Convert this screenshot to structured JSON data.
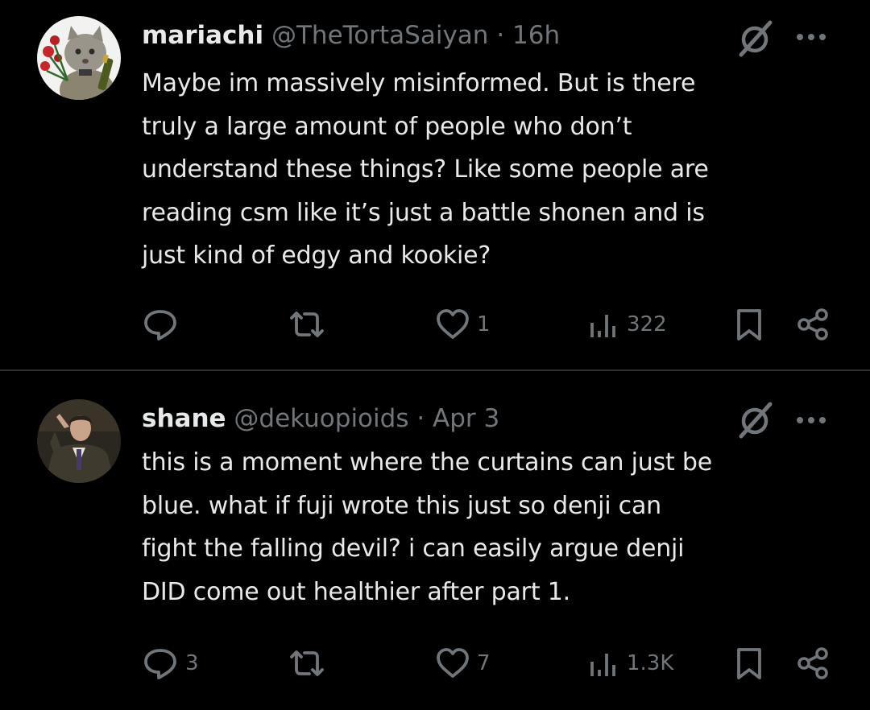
{
  "tweets": [
    {
      "display_name": "mariachi",
      "handle": "@TheTortaSaiyan",
      "separator": "·",
      "time": "16h",
      "text_lines": [
        "Maybe im massively misinformed. But is there",
        "truly a large amount of people who don’t",
        "understand these things? Like some people are",
        "reading csm like it’s just a battle shonen and is",
        "just kind of edgy and kookie?"
      ],
      "replies": "",
      "reposts": "",
      "likes": "1",
      "views": "322"
    },
    {
      "display_name": "shane",
      "handle": "@dekuopioids",
      "separator": "·",
      "time": "Apr 3",
      "text_lines": [
        "this is a moment where the curtains can just be",
        "blue. what if fuji wrote this just so denji can",
        "fight the falling devil? i can easily argue denji",
        "DID come out healthier after part 1."
      ],
      "replies": "3",
      "reposts": "",
      "likes": "7",
      "views": "1.3K"
    }
  ],
  "colors": {
    "background": "#000000",
    "text_primary": "#e7e9ea",
    "text_secondary": "#71767b",
    "divider": "#2f3336"
  },
  "icons": {
    "avatar_1": "cat-with-roses-avatar",
    "avatar_2": "man-in-suit-avatar",
    "grok": "grok-slash-circle-icon",
    "more": "ellipsis-icon",
    "reply": "speech-bubble-icon",
    "repost": "repost-arrows-icon",
    "like": "heart-icon",
    "views": "bar-chart-icon",
    "bookmark": "bookmark-icon",
    "share": "share-nodes-icon"
  }
}
